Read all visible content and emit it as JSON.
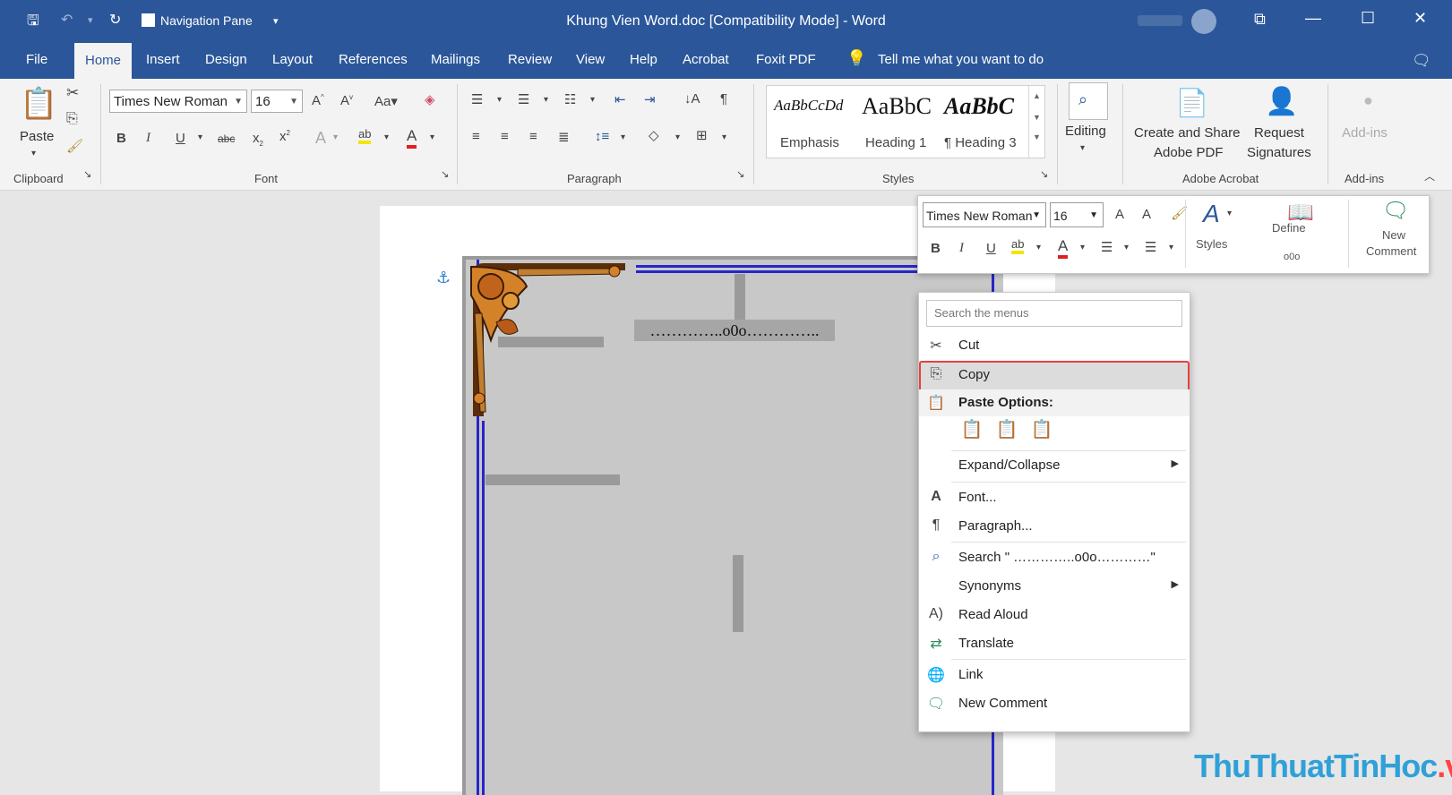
{
  "titlebar": {
    "nav_pane_label": "Navigation Pane",
    "title": "Khung Vien Word.doc [Compatibility Mode]  -  Word"
  },
  "tabs": [
    "File",
    "Home",
    "Insert",
    "Design",
    "Layout",
    "References",
    "Mailings",
    "Review",
    "View",
    "Help",
    "Acrobat",
    "Foxit PDF"
  ],
  "tell_me": "Tell me what you want to do",
  "ribbon": {
    "clipboard": {
      "paste": "Paste",
      "label": "Clipboard"
    },
    "font": {
      "name": "Times New Roman",
      "size": "16",
      "label": "Font"
    },
    "paragraph": {
      "label": "Paragraph"
    },
    "styles": {
      "label": "Styles",
      "items": [
        {
          "preview": "AaBbCcDd",
          "name": "Emphasis"
        },
        {
          "preview": "AaBbC",
          "name": "Heading 1"
        },
        {
          "preview": "AaBbC",
          "name": "¶ Heading 3"
        }
      ]
    },
    "editing": {
      "label": "Editing"
    },
    "acrobat": {
      "create_share": "Create and Share",
      "adobe_pdf": "Adobe PDF",
      "request": "Request",
      "signatures": "Signatures",
      "label": "Adobe Acrobat"
    },
    "addins": {
      "btn": "Add-ins",
      "label": "Add-ins"
    }
  },
  "document": {
    "text": "…………..o0o………….."
  },
  "mini_toolbar": {
    "font": "Times New Roman",
    "size": "16",
    "styles": "Styles",
    "define": "Define",
    "define_sub": "o0o",
    "new_comment_1": "New",
    "new_comment_2": "Comment"
  },
  "context_menu": {
    "search_placeholder": "Search the menus",
    "cut": "Cut",
    "copy": "Copy",
    "paste_options": "Paste Options:",
    "expand_collapse": "Expand/Collapse",
    "font": "Font...",
    "paragraph": "Paragraph...",
    "search": "Search \"   …………..o0o…………\"",
    "synonyms": "Synonyms",
    "read_aloud": "Read Aloud",
    "translate": "Translate",
    "link": "Link",
    "new_comment": "New Comment"
  },
  "watermark": {
    "text_a": "ThuThuatTinHoc",
    "text_b": ".vn"
  },
  "colors": {
    "accent": "#2b579a",
    "highlight_border": "#e8403c",
    "highlight_fill": "#dcdcdc"
  }
}
